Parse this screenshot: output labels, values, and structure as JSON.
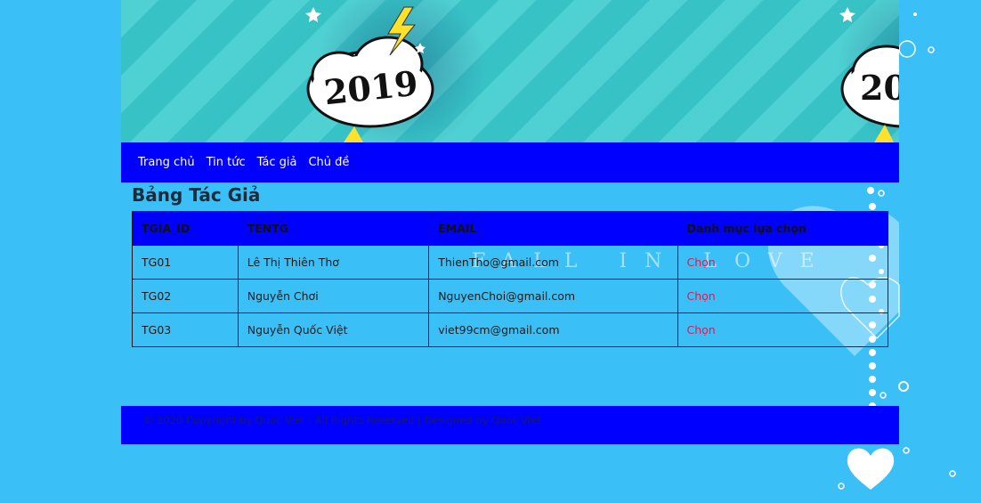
{
  "banner": {
    "badge_text": "2019"
  },
  "nav": {
    "items": [
      {
        "label": "Trang chủ"
      },
      {
        "label": "Tin tức"
      },
      {
        "label": "Tác giả"
      },
      {
        "label": "Chủ đề"
      }
    ]
  },
  "page": {
    "title": "Bảng Tác Giả"
  },
  "table": {
    "headers": [
      "TGIA_ID",
      "TENTG",
      "EMAIL",
      "Danh mục lựa chọn"
    ],
    "rows": [
      {
        "id": "TG01",
        "name": "Lê Thị Thiên Thơ",
        "email": "ThienTho@gmail.com",
        "action": "Chọn"
      },
      {
        "id": "TG02",
        "name": "Nguyễn Chơi",
        "email": "NguyenChoi@gmail.com",
        "action": "Chọn"
      },
      {
        "id": "TG03",
        "name": "Nguyễn Quốc Việt",
        "email": "viet99cm@gmail.com",
        "action": "Chọn"
      }
    ]
  },
  "background": {
    "watermark": "FALL IN LOVE"
  },
  "footer": {
    "text": "© 2020 Copyright by Quoc Viet - All Rights Reserved | Designed by Quoc Viet"
  },
  "colors": {
    "page_bg": "#3bbff7",
    "nav_bg": "#0000ff",
    "link_red": "#e8174d",
    "banner_teal": "#38c5c7"
  }
}
